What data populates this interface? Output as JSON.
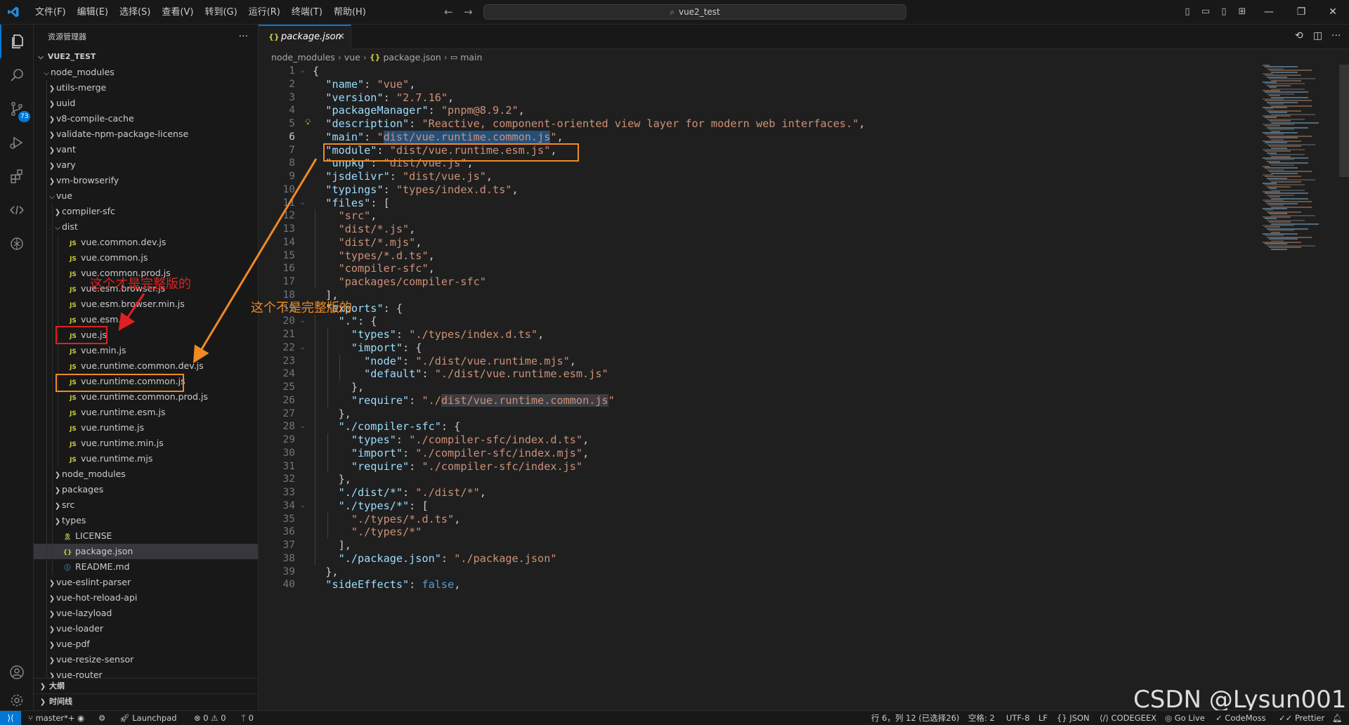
{
  "menu": [
    "文件(F)",
    "编辑(E)",
    "选择(S)",
    "查看(V)",
    "转到(G)",
    "运行(R)",
    "终端(T)",
    "帮助(H)"
  ],
  "command_center": "vue2_test",
  "activity": {
    "source_control_badge": "73"
  },
  "sidebar": {
    "title": "资源管理器",
    "root": "VUE2_TEST",
    "tree": [
      {
        "label": "node_modules",
        "type": "folder-open",
        "depth": 1
      },
      {
        "label": "utils-merge",
        "type": "folder",
        "depth": 2
      },
      {
        "label": "uuid",
        "type": "folder",
        "depth": 2
      },
      {
        "label": "v8-compile-cache",
        "type": "folder",
        "depth": 2
      },
      {
        "label": "validate-npm-package-license",
        "type": "folder",
        "depth": 2
      },
      {
        "label": "vant",
        "type": "folder",
        "depth": 2
      },
      {
        "label": "vary",
        "type": "folder",
        "depth": 2
      },
      {
        "label": "vm-browserify",
        "type": "folder",
        "depth": 2
      },
      {
        "label": "vue",
        "type": "folder-open",
        "depth": 2
      },
      {
        "label": "compiler-sfc",
        "type": "folder",
        "depth": 3
      },
      {
        "label": "dist",
        "type": "folder-open",
        "depth": 3
      },
      {
        "label": "vue.common.dev.js",
        "type": "js",
        "depth": 4
      },
      {
        "label": "vue.common.js",
        "type": "js",
        "depth": 4
      },
      {
        "label": "vue.common.prod.js",
        "type": "js",
        "depth": 4
      },
      {
        "label": "vue.esm.browser.js",
        "type": "js",
        "depth": 4
      },
      {
        "label": "vue.esm.browser.min.js",
        "type": "js",
        "depth": 4
      },
      {
        "label": "vue.esm.js",
        "type": "js",
        "depth": 4
      },
      {
        "label": "vue.js",
        "type": "js",
        "depth": 4
      },
      {
        "label": "vue.min.js",
        "type": "js",
        "depth": 4
      },
      {
        "label": "vue.runtime.common.dev.js",
        "type": "js",
        "depth": 4
      },
      {
        "label": "vue.runtime.common.js",
        "type": "js",
        "depth": 4
      },
      {
        "label": "vue.runtime.common.prod.js",
        "type": "js",
        "depth": 4
      },
      {
        "label": "vue.runtime.esm.js",
        "type": "js",
        "depth": 4
      },
      {
        "label": "vue.runtime.js",
        "type": "js",
        "depth": 4
      },
      {
        "label": "vue.runtime.min.js",
        "type": "js",
        "depth": 4
      },
      {
        "label": "vue.runtime.mjs",
        "type": "js",
        "depth": 4
      },
      {
        "label": "node_modules",
        "type": "folder",
        "depth": 3
      },
      {
        "label": "packages",
        "type": "folder",
        "depth": 3
      },
      {
        "label": "src",
        "type": "folder",
        "depth": 3
      },
      {
        "label": "types",
        "type": "folder",
        "depth": 3
      },
      {
        "label": "LICENSE",
        "type": "license",
        "depth": 3
      },
      {
        "label": "package.json",
        "type": "json",
        "depth": 3,
        "selected": true
      },
      {
        "label": "README.md",
        "type": "info",
        "depth": 3
      },
      {
        "label": "vue-eslint-parser",
        "type": "folder",
        "depth": 2
      },
      {
        "label": "vue-hot-reload-api",
        "type": "folder",
        "depth": 2
      },
      {
        "label": "vue-lazyload",
        "type": "folder",
        "depth": 2
      },
      {
        "label": "vue-loader",
        "type": "folder",
        "depth": 2
      },
      {
        "label": "vue-pdf",
        "type": "folder",
        "depth": 2
      },
      {
        "label": "vue-resize-sensor",
        "type": "folder",
        "depth": 2
      },
      {
        "label": "vue-router",
        "type": "folder",
        "depth": 2
      }
    ],
    "outline_label": "大纲",
    "timeline_label": "时间线"
  },
  "editor": {
    "tab_label": "package.json",
    "breadcrumb": [
      "node_modules",
      "vue",
      "package.json",
      "main"
    ],
    "current_line": 6,
    "lines": [
      [
        [
          "p",
          "{"
        ]
      ],
      [
        [
          "p",
          "  "
        ],
        [
          "k",
          "\"name\""
        ],
        [
          "p",
          ": "
        ],
        [
          "s",
          "\"vue\""
        ],
        [
          "p",
          ","
        ]
      ],
      [
        [
          "p",
          "  "
        ],
        [
          "k",
          "\"version\""
        ],
        [
          "p",
          ": "
        ],
        [
          "s",
          "\"2.7.16\""
        ],
        [
          "p",
          ","
        ]
      ],
      [
        [
          "p",
          "  "
        ],
        [
          "k",
          "\"packageManager\""
        ],
        [
          "p",
          ": "
        ],
        [
          "s",
          "\"pnpm@8.9.2\""
        ],
        [
          "p",
          ","
        ]
      ],
      [
        [
          "p",
          "  "
        ],
        [
          "k",
          "\"description\""
        ],
        [
          "p",
          ": "
        ],
        [
          "s",
          "\"Reactive, component-oriented view layer for modern web interfaces.\""
        ],
        [
          "p",
          ","
        ]
      ],
      [
        [
          "p",
          "  "
        ],
        [
          "k",
          "\"main\""
        ],
        [
          "p",
          ": "
        ],
        [
          "s",
          "\""
        ],
        [
          "sel",
          "dist/vue.runtime.common.js"
        ],
        [
          "s",
          "\""
        ],
        [
          "p",
          ","
        ]
      ],
      [
        [
          "p",
          "  "
        ],
        [
          "k",
          "\"module\""
        ],
        [
          "p",
          ": "
        ],
        [
          "s",
          "\"dist/vue.runtime.esm.js\""
        ],
        [
          "p",
          ","
        ]
      ],
      [
        [
          "p",
          "  "
        ],
        [
          "k",
          "\"unpkg\""
        ],
        [
          "p",
          ": "
        ],
        [
          "s",
          "\"dist/vue.js\""
        ],
        [
          "p",
          ","
        ]
      ],
      [
        [
          "p",
          "  "
        ],
        [
          "k",
          "\"jsdelivr\""
        ],
        [
          "p",
          ": "
        ],
        [
          "s",
          "\"dist/vue.js\""
        ],
        [
          "p",
          ","
        ]
      ],
      [
        [
          "p",
          "  "
        ],
        [
          "k",
          "\"typings\""
        ],
        [
          "p",
          ": "
        ],
        [
          "s",
          "\"types/index.d.ts\""
        ],
        [
          "p",
          ","
        ]
      ],
      [
        [
          "p",
          "  "
        ],
        [
          "k",
          "\"files\""
        ],
        [
          "p",
          ": ["
        ]
      ],
      [
        [
          "p",
          "    "
        ],
        [
          "s",
          "\"src\""
        ],
        [
          "p",
          ","
        ]
      ],
      [
        [
          "p",
          "    "
        ],
        [
          "s",
          "\"dist/*.js\""
        ],
        [
          "p",
          ","
        ]
      ],
      [
        [
          "p",
          "    "
        ],
        [
          "s",
          "\"dist/*.mjs\""
        ],
        [
          "p",
          ","
        ]
      ],
      [
        [
          "p",
          "    "
        ],
        [
          "s",
          "\"types/*.d.ts\""
        ],
        [
          "p",
          ","
        ]
      ],
      [
        [
          "p",
          "    "
        ],
        [
          "s",
          "\"compiler-sfc\""
        ],
        [
          "p",
          ","
        ]
      ],
      [
        [
          "p",
          "    "
        ],
        [
          "s",
          "\"packages/compiler-sfc\""
        ]
      ],
      [
        [
          "p",
          "  ],"
        ]
      ],
      [
        [
          "p",
          "  "
        ],
        [
          "k",
          "\"exports\""
        ],
        [
          "p",
          ": {"
        ]
      ],
      [
        [
          "p",
          "    "
        ],
        [
          "k",
          "\".\""
        ],
        [
          "p",
          ": {"
        ]
      ],
      [
        [
          "p",
          "      "
        ],
        [
          "k",
          "\"types\""
        ],
        [
          "p",
          ": "
        ],
        [
          "s",
          "\"./types/index.d.ts\""
        ],
        [
          "p",
          ","
        ]
      ],
      [
        [
          "p",
          "      "
        ],
        [
          "k",
          "\"import\""
        ],
        [
          "p",
          ": {"
        ]
      ],
      [
        [
          "p",
          "        "
        ],
        [
          "k",
          "\"node\""
        ],
        [
          "p",
          ": "
        ],
        [
          "s",
          "\"./dist/vue.runtime.mjs\""
        ],
        [
          "p",
          ","
        ]
      ],
      [
        [
          "p",
          "        "
        ],
        [
          "k",
          "\"default\""
        ],
        [
          "p",
          ": "
        ],
        [
          "s",
          "\"./dist/vue.runtime.esm.js\""
        ]
      ],
      [
        [
          "p",
          "      },"
        ]
      ],
      [
        [
          "p",
          "      "
        ],
        [
          "k",
          "\"require\""
        ],
        [
          "p",
          ": "
        ],
        [
          "s",
          "\"./"
        ],
        [
          "word",
          "dist/vue.runtime.common.js"
        ],
        [
          "s",
          "\""
        ]
      ],
      [
        [
          "p",
          "    },"
        ]
      ],
      [
        [
          "p",
          "    "
        ],
        [
          "k",
          "\"./compiler-sfc\""
        ],
        [
          "p",
          ": {"
        ]
      ],
      [
        [
          "p",
          "      "
        ],
        [
          "k",
          "\"types\""
        ],
        [
          "p",
          ": "
        ],
        [
          "s",
          "\"./compiler-sfc/index.d.ts\""
        ],
        [
          "p",
          ","
        ]
      ],
      [
        [
          "p",
          "      "
        ],
        [
          "k",
          "\"import\""
        ],
        [
          "p",
          ": "
        ],
        [
          "s",
          "\"./compiler-sfc/index.mjs\""
        ],
        [
          "p",
          ","
        ]
      ],
      [
        [
          "p",
          "      "
        ],
        [
          "k",
          "\"require\""
        ],
        [
          "p",
          ": "
        ],
        [
          "s",
          "\"./compiler-sfc/index.js\""
        ]
      ],
      [
        [
          "p",
          "    },"
        ]
      ],
      [
        [
          "p",
          "    "
        ],
        [
          "k",
          "\"./dist/*\""
        ],
        [
          "p",
          ": "
        ],
        [
          "s",
          "\"./dist/*\""
        ],
        [
          "p",
          ","
        ]
      ],
      [
        [
          "p",
          "    "
        ],
        [
          "k",
          "\"./types/*\""
        ],
        [
          "p",
          ": ["
        ]
      ],
      [
        [
          "p",
          "      "
        ],
        [
          "s",
          "\"./types/*.d.ts\""
        ],
        [
          "p",
          ","
        ]
      ],
      [
        [
          "p",
          "      "
        ],
        [
          "s",
          "\"./types/*\""
        ]
      ],
      [
        [
          "p",
          "    ],"
        ]
      ],
      [
        [
          "p",
          "    "
        ],
        [
          "k",
          "\"./package.json\""
        ],
        [
          "p",
          ": "
        ],
        [
          "s",
          "\"./package.json\""
        ]
      ],
      [
        [
          "p",
          "  },"
        ]
      ],
      [
        [
          "p",
          "  "
        ],
        [
          "k",
          "\"sideEffects\""
        ],
        [
          "p",
          ": "
        ],
        [
          "b",
          "false"
        ],
        [
          "p",
          ","
        ]
      ]
    ]
  },
  "annotations": {
    "red_text": "这个才是完整版的",
    "orange_text": "这个不是完整版的",
    "red_color": "#e02020",
    "orange_color": "#f08a24"
  },
  "watermark": "CSDN @Lysun001",
  "statusbar": {
    "branch": "master*+",
    "launchpad": "Launchpad",
    "problems": "⊗ 0 ⚠ 0",
    "ports": "0",
    "position": "行 6，列 12 (已选择26)",
    "spaces": "空格: 2",
    "encoding": "UTF-8",
    "eol": "LF",
    "language": "JSON",
    "codegeex": "CODEGEEX",
    "golive": "Go Live",
    "codemoss": "CodeMoss",
    "prettier": "Prettier"
  }
}
